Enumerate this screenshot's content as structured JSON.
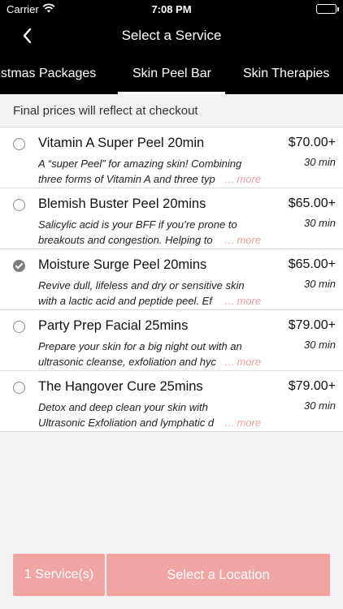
{
  "status_bar": {
    "carrier": "Carrier",
    "time": "7:08 PM"
  },
  "nav": {
    "title": "Select a Service"
  },
  "tabs": [
    {
      "label": "ristmas Packages"
    },
    {
      "label": "Skin Peel Bar"
    },
    {
      "label": "Skin Therapies"
    }
  ],
  "active_tab": "Skin Peel Bar",
  "notice": "Final prices will reflect at checkout",
  "services": [
    {
      "name": "Vitamin A Super Peel 20min",
      "price": "$70.00+",
      "duration": "30 min",
      "description": "A “super Peel” for amazing skin! Combining three forms of Vitamin A and three typ",
      "more": "... more",
      "selected": false
    },
    {
      "name": "Blemish Buster Peel 20mins",
      "price": "$65.00+",
      "duration": "30 min",
      "description": "Salicylic acid is your BFF if you’re prone to breakouts and congestion. Helping to",
      "more": "... more",
      "selected": false
    },
    {
      "name": "Moisture Surge Peel 20mins",
      "price": "$65.00+",
      "duration": "30 min",
      "description": "Revive dull, lifeless and dry or sensitive skin with a lactic acid and peptide peel. Ef",
      "more": "... more",
      "selected": true
    },
    {
      "name": "Party Prep Facial 25mins",
      "price": "$79.00+",
      "duration": "30 min",
      "description": "Prepare your skin for a big night out with an ultrasonic cleanse, exfoliation and hyc",
      "more": "... more",
      "selected": false
    },
    {
      "name": "The Hangover Cure 25mins",
      "price": "$79.00+",
      "duration": "30 min",
      "description": "Detox and deep clean your skin with Ultrasonic Exfoliation and lymphatic d",
      "more": "... more",
      "selected": false
    }
  ],
  "footer": {
    "count_label": "1 Service(s)",
    "location_label": "Select a Location"
  },
  "colors": {
    "accent": "#f1a5a3",
    "more_link": "#e8a0a0",
    "header_bg": "#000000"
  },
  "icons": {
    "back": "chevron-left-icon",
    "wifi": "wifi-icon",
    "battery": "battery-icon",
    "radio": "radio-icon"
  }
}
